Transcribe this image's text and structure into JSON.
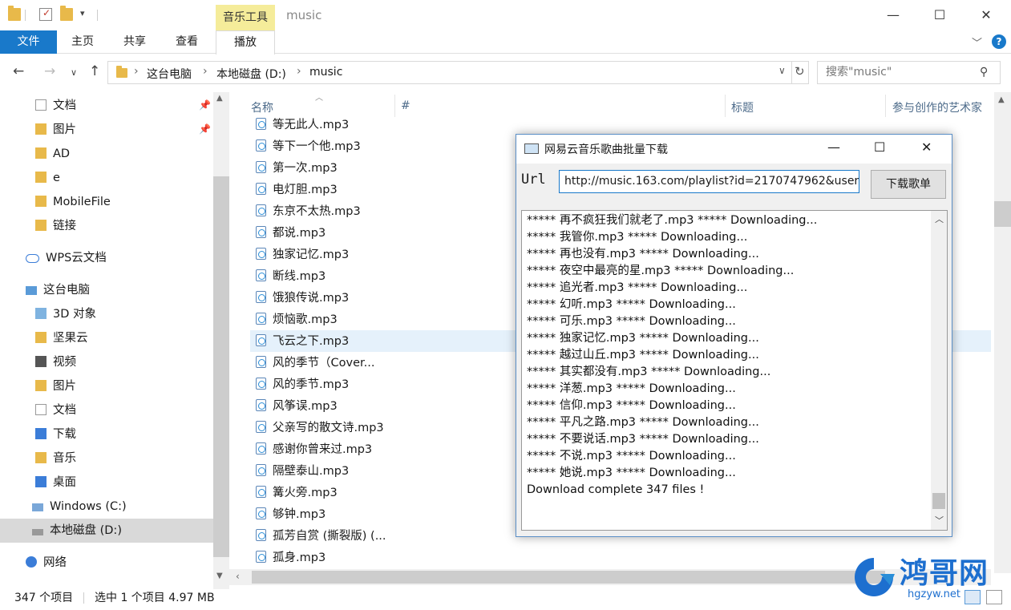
{
  "window": {
    "title": "music",
    "ribbon_context_tab": "音乐工具",
    "minimize": "—",
    "maximize": "☐",
    "close": "✕"
  },
  "ribbon": {
    "file": "文件",
    "tabs": [
      "主页",
      "共享",
      "查看"
    ],
    "play": "播放"
  },
  "address": {
    "crumbs": [
      "这台电脑",
      "本地磁盘 (D:)",
      "music"
    ],
    "search_placeholder": "搜索\"music\""
  },
  "nav": {
    "items": [
      {
        "label": "文档",
        "pinned": true
      },
      {
        "label": "图片",
        "pinned": true
      },
      {
        "label": "AD"
      },
      {
        "label": "e"
      },
      {
        "label": "MobileFile"
      },
      {
        "label": "链接"
      },
      {
        "label": "WPS云文档"
      },
      {
        "label": "这台电脑"
      },
      {
        "label": "3D 对象"
      },
      {
        "label": "坚果云"
      },
      {
        "label": "视频"
      },
      {
        "label": "图片"
      },
      {
        "label": "文档"
      },
      {
        "label": "下载"
      },
      {
        "label": "音乐"
      },
      {
        "label": "桌面"
      },
      {
        "label": "Windows (C:)"
      },
      {
        "label": "本地磁盘 (D:)"
      },
      {
        "label": "网络"
      }
    ]
  },
  "columns": [
    "名称",
    "#",
    "标题",
    "参与创作的艺术家"
  ],
  "files": [
    "等无此人.mp3",
    "等下一个他.mp3",
    "第一次.mp3",
    "电灯胆.mp3",
    "东京不太热.mp3",
    "都说.mp3",
    "独家记忆.mp3",
    "断线.mp3",
    "饿狼传说.mp3",
    "烦恼歌.mp3",
    "飞云之下.mp3",
    "风的季节（Cover...",
    "风的季节.mp3",
    "风筝误.mp3",
    "父亲写的散文诗.mp3",
    "感谢你曾来过.mp3",
    "隔壁泰山.mp3",
    "篝火旁.mp3",
    "够钟.mp3",
    "孤芳自赏 (撕裂版) (...",
    "孤身.mp3"
  ],
  "status": {
    "count": "347 个项目",
    "selection": "选中 1 个项目  4.97 MB"
  },
  "dialog": {
    "title": "网易云音乐歌曲批量下载",
    "url_label": "Url",
    "url_value": "http://music.163.com/playlist?id=2170747962&user",
    "button": "下载歌单",
    "log": [
      "***** 再不疯狂我们就老了.mp3 ***** Downloading...",
      "***** 我管你.mp3 ***** Downloading...",
      "***** 再也没有.mp3 ***** Downloading...",
      "***** 夜空中最亮的星.mp3 ***** Downloading...",
      "***** 追光者.mp3 ***** Downloading...",
      "***** 幻听.mp3 ***** Downloading...",
      "***** 可乐.mp3 ***** Downloading...",
      "***** 独家记忆.mp3 ***** Downloading...",
      "***** 越过山丘.mp3 ***** Downloading...",
      "***** 其实都没有.mp3 ***** Downloading...",
      "***** 洋葱.mp3 ***** Downloading...",
      "***** 信仰.mp3 ***** Downloading...",
      "***** 平凡之路.mp3 ***** Downloading...",
      "***** 不要说话.mp3 ***** Downloading...",
      "***** 不说.mp3 ***** Downloading...",
      "***** 她说.mp3 ***** Downloading...",
      "Download complete 347 files !"
    ]
  },
  "watermark": {
    "name": "鸿哥网",
    "url": "hgzyw.net"
  },
  "colors": {
    "accent": "#1979ca",
    "selected_row": "#e5f1fb",
    "tool_tab": "#f5ec9a"
  }
}
